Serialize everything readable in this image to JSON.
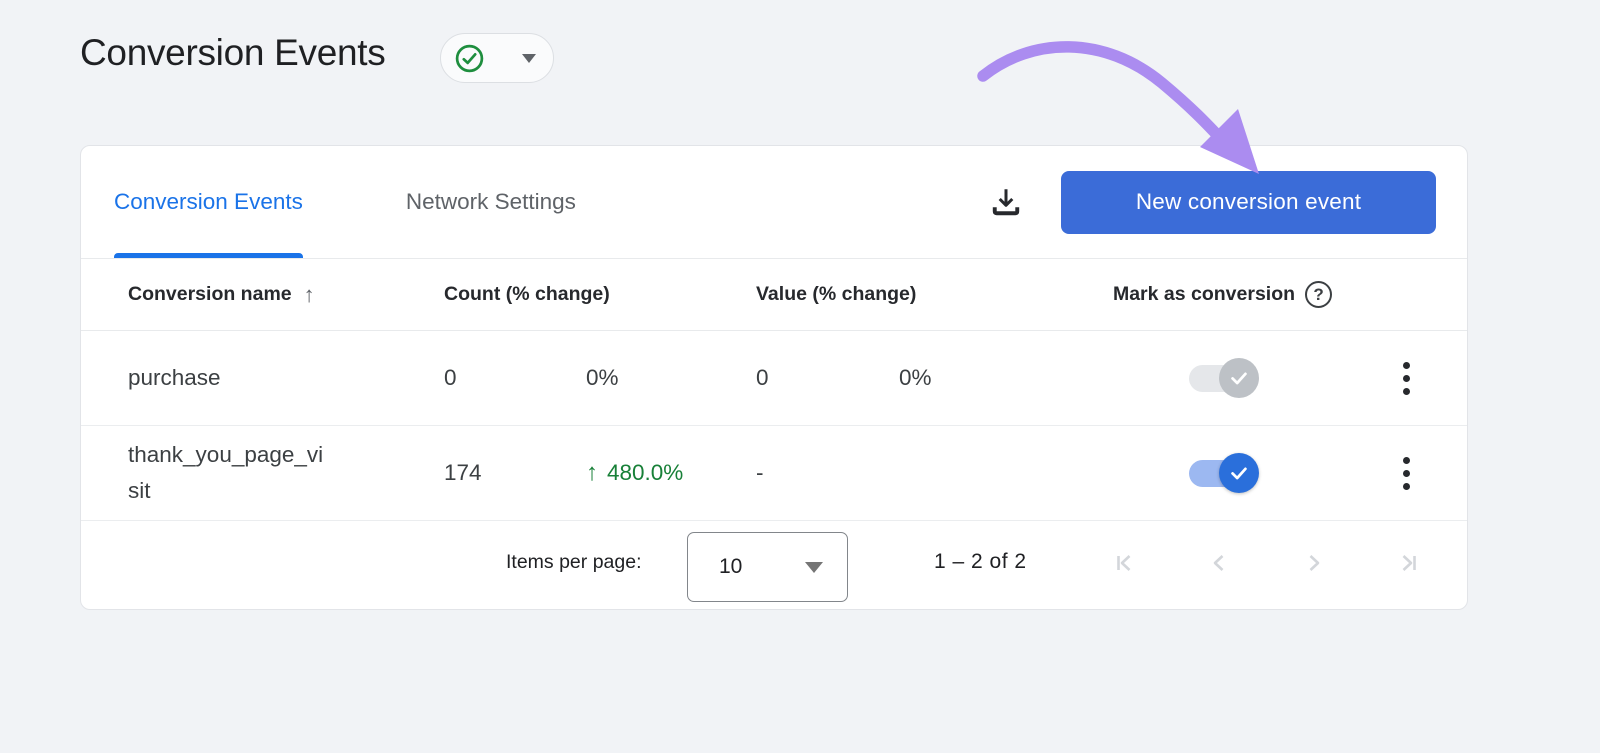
{
  "page": {
    "title": "Conversion Events"
  },
  "title_badge": {
    "status": "verified",
    "caret": "down"
  },
  "icons": {
    "sort_up_glyph": "↑",
    "change_up_glyph": "↑",
    "help_glyph": "?"
  },
  "toolbar": {
    "tabs": [
      {
        "label": "Conversion Events",
        "active": true
      },
      {
        "label": "Network Settings",
        "active": false
      }
    ],
    "new_conversion_button": "New conversion event"
  },
  "table": {
    "headers": {
      "name": "Conversion name",
      "count": "Count (% change)",
      "value": "Value (% change)",
      "mark": "Mark as conversion"
    },
    "rows": [
      {
        "name": "purchase",
        "count": "0",
        "count_change": "0%",
        "value": "0",
        "value_change": "0%",
        "marked": "on-disabled"
      },
      {
        "name": "thank_you_page_visit",
        "count": "174",
        "count_change": "480.0%",
        "count_change_direction": "up",
        "value": "-",
        "value_change": "",
        "marked": "on"
      }
    ]
  },
  "pagination": {
    "items_per_page_label": "Items per page:",
    "items_per_page_value": "10",
    "range_label": "1 – 2 of 2"
  },
  "colors": {
    "page_bg": "#f1f3f6",
    "accent_blue": "#1a73e8",
    "button_blue": "#3b6cd8",
    "toggle_on_blue": "#2a6fdb",
    "green": "#188038",
    "badge_green": "#1e8e3e",
    "annotation_purple": "#ab8cf0",
    "muted_gray": "#5f6368",
    "disabled_gray": "#d6d9dd"
  }
}
